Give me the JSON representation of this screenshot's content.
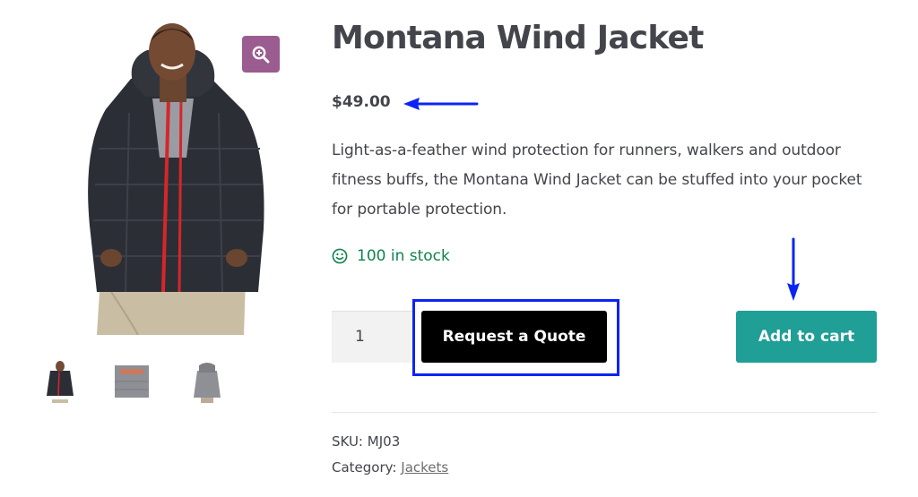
{
  "product": {
    "title": "Montana Wind Jacket",
    "price": "$49.00",
    "description": "Light-as-a-feather wind protection for runners, walkers and outdoor fitness buffs, the Montana Wind Jacket can be stuffed into your pocket for portable protection.",
    "stock": "100 in stock",
    "quantity": "1",
    "sku_label": "SKU:",
    "sku": "MJ03",
    "category_label": "Category:",
    "category": "Jackets"
  },
  "buttons": {
    "request_quote": "Request a Quote",
    "add_to_cart": "Add to cart"
  },
  "gallery": {
    "icon": "zoom-in-icon",
    "thumbnail_count": 3
  },
  "colors": {
    "zoom_bg": "#9b5c8f",
    "stock_green": "#0f834d",
    "cart_teal": "#1f9f96",
    "quote_black": "#000000",
    "annotation_blue": "#0b24f3"
  }
}
